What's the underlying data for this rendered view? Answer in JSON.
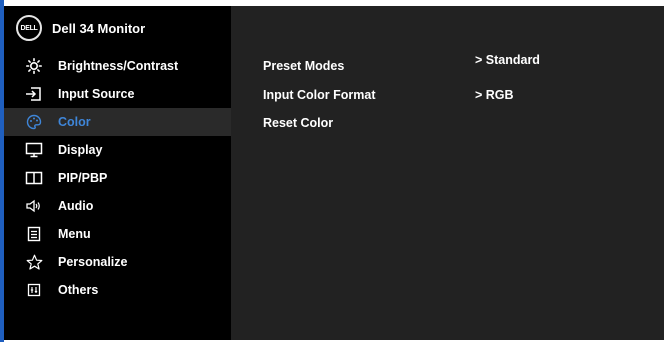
{
  "header": {
    "logo_text": "DELL",
    "title": "Dell 34 Monitor"
  },
  "colors": {
    "accent": "#3f86d9",
    "sidebar_bg": "#000000",
    "content_bg": "#222222",
    "text": "#ffffff"
  },
  "sidebar": {
    "active_index": 2,
    "items": [
      {
        "label": "Brightness/Contrast",
        "icon": "brightness-icon"
      },
      {
        "label": "Input Source",
        "icon": "input-source-icon"
      },
      {
        "label": "Color",
        "icon": "color-palette-icon"
      },
      {
        "label": "Display",
        "icon": "display-icon"
      },
      {
        "label": "PIP/PBP",
        "icon": "pip-pbp-icon"
      },
      {
        "label": "Audio",
        "icon": "audio-icon"
      },
      {
        "label": "Menu",
        "icon": "menu-icon"
      },
      {
        "label": "Personalize",
        "icon": "star-icon"
      },
      {
        "label": "Others",
        "icon": "others-icon"
      }
    ]
  },
  "color_menu": {
    "rows": [
      {
        "label": "Preset Modes",
        "value": "> Standard"
      },
      {
        "label": "Input Color Format",
        "value": "> RGB"
      },
      {
        "label": "Reset Color",
        "value": ""
      }
    ]
  }
}
